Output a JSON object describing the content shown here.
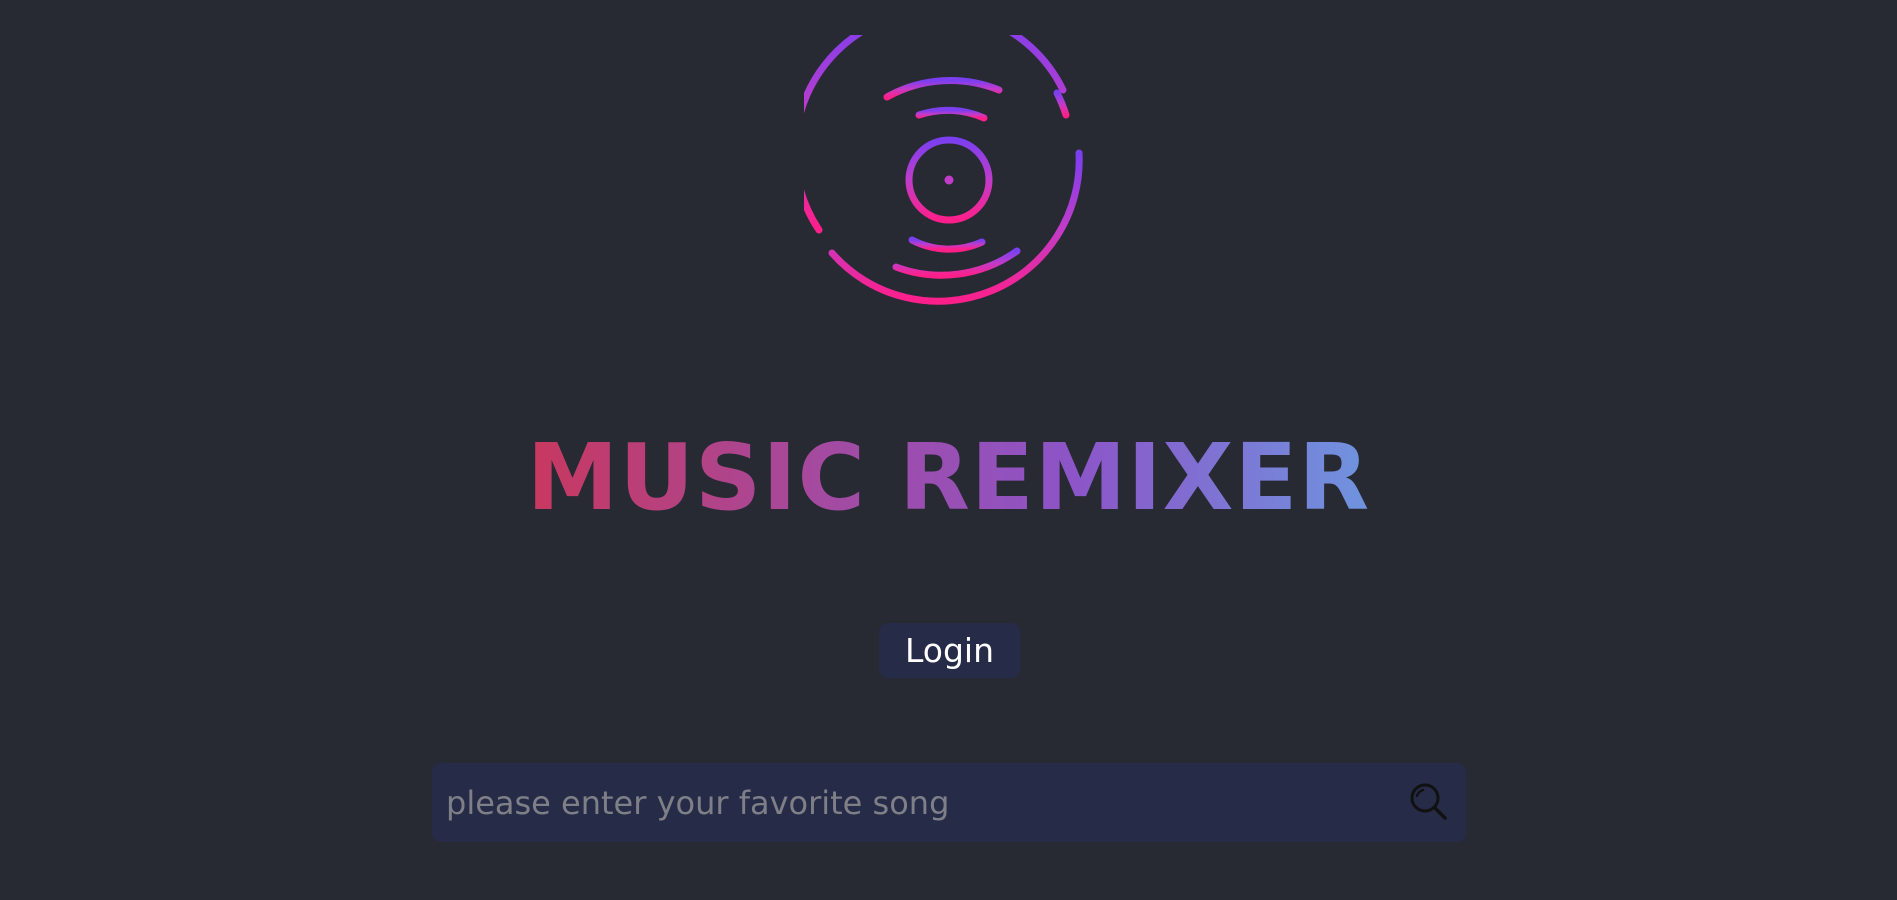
{
  "app": {
    "title": "MUSIC REMIXER"
  },
  "logo": {
    "icon": "vinyl-record-icon",
    "gradient_top": "#7b3ff0",
    "gradient_bottom": "#ff1f8a"
  },
  "header": {
    "title": "MUSIC REMIXER"
  },
  "actions": {
    "login_label": "Login"
  },
  "search": {
    "placeholder": "please enter your favorite song",
    "value": "",
    "icon": "search-icon"
  },
  "colors": {
    "background": "#272a33",
    "panel": "#262b48",
    "title_gradient_start": "#c8385f",
    "title_gradient_end": "#6f94df"
  }
}
